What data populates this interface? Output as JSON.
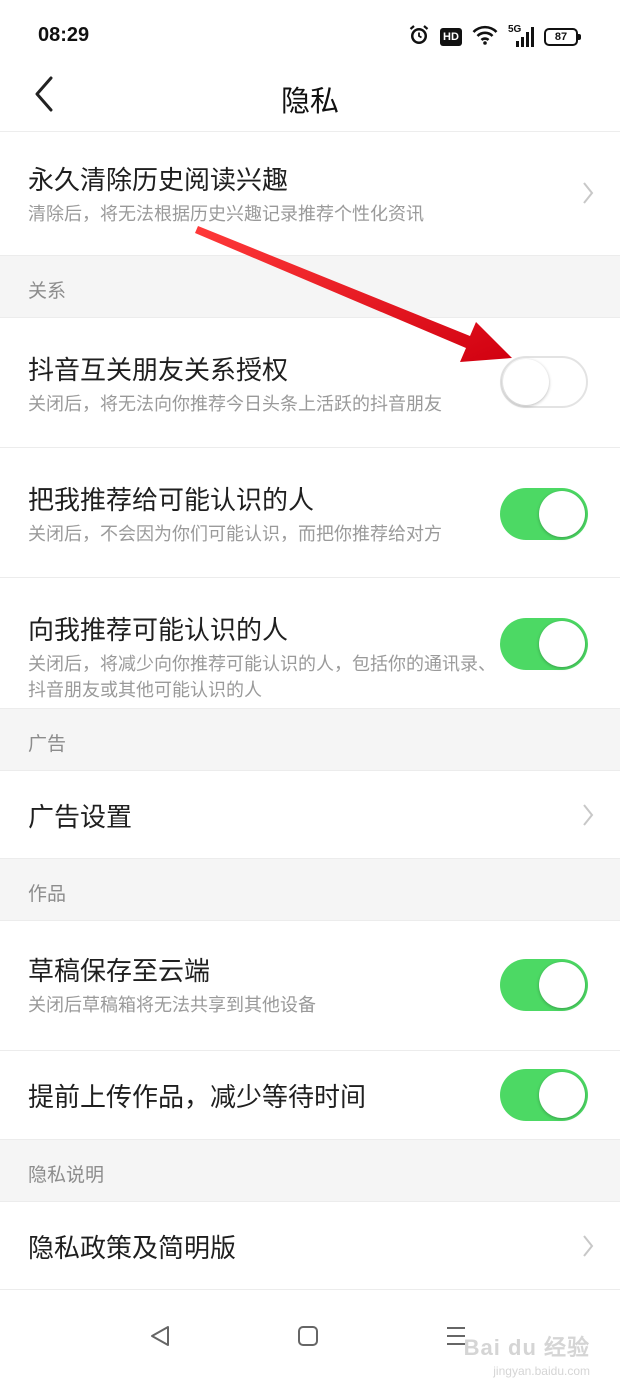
{
  "status_bar": {
    "time": "08:29",
    "hd_label": "HD",
    "network_label": "5G",
    "battery_level": "87"
  },
  "header": {
    "title": "隐私"
  },
  "rows": {
    "clear_history": {
      "title": "永久清除历史阅读兴趣",
      "subtitle": "清除后，将无法根据历史兴趣记录推荐个性化资讯"
    },
    "douyin_auth": {
      "title": "抖音互关朋友关系授权",
      "subtitle": "关闭后，将无法向你推荐今日头条上活跃的抖音朋友",
      "enabled": false
    },
    "recommend_me": {
      "title": "把我推荐给可能认识的人",
      "subtitle": "关闭后，不会因为你们可能认识，而把你推荐给对方",
      "enabled": true
    },
    "recommend_to_me": {
      "title": "向我推荐可能认识的人",
      "subtitle": "关闭后，将减少向你推荐可能认识的人，包括你的通讯录、抖音朋友或其他可能认识的人",
      "enabled": true
    },
    "ad_settings": {
      "title": "广告设置"
    },
    "draft_cloud": {
      "title": "草稿保存至云端",
      "subtitle": "关闭后草稿箱将无法共享到其他设备",
      "enabled": true
    },
    "pre_upload": {
      "title": "提前上传作品，减少等待时间",
      "enabled": true
    },
    "privacy_policy": {
      "title": "隐私政策及简明版"
    }
  },
  "sections": {
    "relations": "关系",
    "ads": "广告",
    "works": "作品",
    "privacy_notes": "隐私说明"
  },
  "watermark": {
    "main": "Bai du 经验",
    "sub": "jingyan.baidu.com"
  },
  "colors": {
    "toggle_on": "#4cd964",
    "section_bg": "#f5f5f5",
    "annotation_arrow": "#e8141c"
  },
  "icons": {
    "back": "chevron-left-icon",
    "row_chevron": "chevron-right-icon",
    "alarm": "alarm-icon",
    "wifi": "wifi-icon",
    "signal": "signal-icon",
    "battery": "battery-icon",
    "sys_back": "triangle-back-icon",
    "sys_home": "square-home-icon",
    "sys_menu": "menu-lines-icon"
  }
}
